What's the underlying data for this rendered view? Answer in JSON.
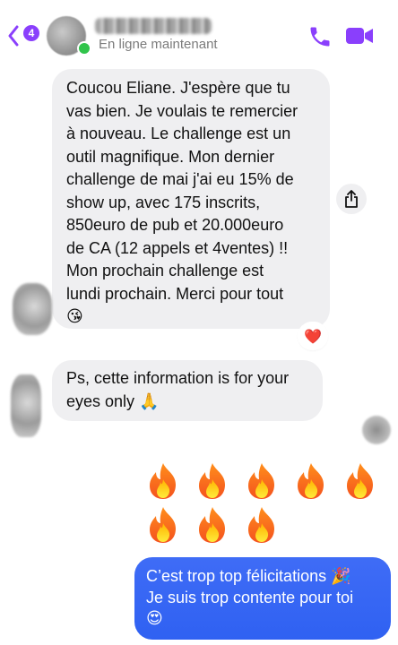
{
  "header": {
    "unread_badge": "4",
    "status": "En ligne maintenant",
    "icons": {
      "back": "chevron-left-icon",
      "call": "phone-icon",
      "video": "video-camera-icon"
    }
  },
  "messages": {
    "incoming_1_lines": [
      "Coucou Eliane. J'espère que tu",
      "vas bien. Je voulais te remercier",
      "à nouveau. Le challenge est un",
      "outil magnifique. Mon dernier",
      "challenge de mai j'ai eu 15% de",
      "show up, avec 175 inscrits,",
      "850euro de pub et 20.000euro",
      "de CA (12 appels et 4ventes) !!",
      "Mon prochain challenge est",
      "lundi prochain. Merci pour tout"
    ],
    "incoming_1_emoji": "😘",
    "incoming_1_reaction": "❤️",
    "incoming_2_lines": [
      "Ps, cette information is for your",
      "eyes only 🙏"
    ],
    "outgoing_fire": [
      "🔥",
      "🔥",
      "🔥",
      "🔥",
      "🔥",
      "🔥",
      "🔥",
      "🔥"
    ],
    "outgoing_1_lines": [
      "C’est trop top félicitations 🎉",
      "Je suis trop contente pour toi",
      "😍"
    ]
  },
  "colors": {
    "accent": "#8a3ffc",
    "incoming_bubble": "#efeff1",
    "outgoing_bubble": "#3166f4",
    "online": "#31c44b"
  }
}
